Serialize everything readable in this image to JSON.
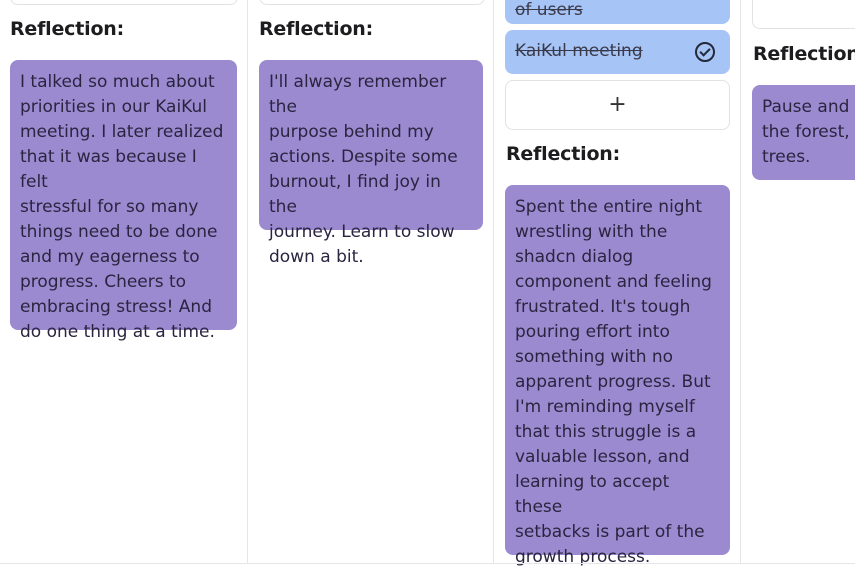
{
  "columns": [
    {
      "heading": "Reflection:",
      "reflection": "I talked so much about\npriorities in our KaiKul\nmeeting. I later realized\nthat it was because I felt\nstressful for so many\nthings need to be done\nand my eagerness to\nprogress. Cheers to\nembracing stress! And\ndo one thing at a time."
    },
    {
      "heading": "Reflection:",
      "reflection": "I'll always remember the\npurpose behind my\nactions. Despite some\nburnout, I find joy in the\njourney. Learn to slow\ndown a bit."
    },
    {
      "heading": "Reflection:",
      "tasks": [
        {
          "title": "of users",
          "completed": true
        },
        {
          "title": "KaiKul meeting",
          "completed": true
        }
      ],
      "add_label": "+",
      "reflection": "Spent the entire night\nwrestling with the\nshadcn dialog\ncomponent and feeling\nfrustrated. It's tough\npouring effort into\nsomething with no\napparent progress. But\nI'm reminding myself\nthat this struggle is a\nvaluable lesson, and\nlearning to accept these\nsetbacks is part of the\ngrowth process."
    },
    {
      "heading": "Reflection:",
      "reflection": "Pause and l\nthe forest, r\ntrees."
    }
  ],
  "colors": {
    "reflection_card": "#9b8acf",
    "task_card": "#a6c4f5",
    "border": "#e6e6ea"
  },
  "icons": {
    "task_check": "check-circle-icon",
    "add": "plus-icon"
  }
}
